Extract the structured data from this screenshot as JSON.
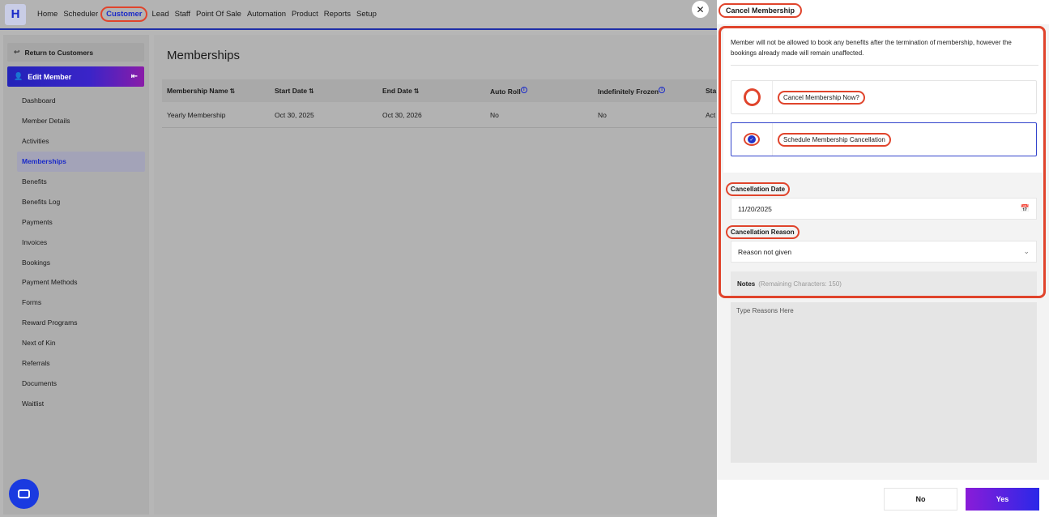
{
  "app": {
    "logo": "H"
  },
  "nav": {
    "items": [
      "Home",
      "Scheduler",
      "Customer",
      "Lead",
      "Staff",
      "Point Of Sale",
      "Automation",
      "Product",
      "Reports",
      "Setup"
    ],
    "active": "Customer"
  },
  "sidebar": {
    "return_label": "Return to Customers",
    "edit_member_label": "Edit Member",
    "items": [
      "Dashboard",
      "Member Details",
      "Activities",
      "Memberships",
      "Benefits",
      "Benefits Log",
      "Payments",
      "Invoices",
      "Bookings",
      "Payment Methods",
      "Forms",
      "Reward Programs",
      "Next of Kin",
      "Referrals",
      "Documents",
      "Waitlist"
    ],
    "active": "Memberships"
  },
  "main": {
    "title": "Memberships",
    "table": {
      "headers": [
        "Membership Name",
        "Start Date",
        "End Date",
        "Auto Roll",
        "Indefinitely Frozen",
        "Sta"
      ],
      "rows": [
        [
          "Yearly Membership",
          "Oct 30, 2025",
          "Oct 30, 2026",
          "No",
          "No",
          "Act"
        ]
      ]
    }
  },
  "drawer": {
    "title": "Cancel Membership",
    "note": "Member will not be allowed to book any benefits after the termination of membership, however the bookings already made will remain unaffected.",
    "options": [
      {
        "label": "Cancel Membership Now?",
        "selected": false
      },
      {
        "label": "Schedule Membership Cancellation",
        "selected": true
      }
    ],
    "cancellation_date_label": "Cancellation Date",
    "cancellation_date_value": "11/20/2025",
    "cancellation_reason_label": "Cancellation Reason",
    "cancellation_reason_value": "Reason not given",
    "notes_label": "Notes",
    "notes_remaining": "(Remaining Characters: 150)",
    "notes_placeholder": "Type Reasons Here",
    "btn_no": "No",
    "btn_yes": "Yes"
  },
  "colors": {
    "accent": "#1a2ac8",
    "highlight": "#e0442c"
  },
  "icons": [
    "close-icon",
    "calendar-icon",
    "chevron-down-icon",
    "user-icon",
    "back-arrow-icon",
    "collapse-icon",
    "info-icon",
    "sort-icon",
    "chat-icon"
  ]
}
